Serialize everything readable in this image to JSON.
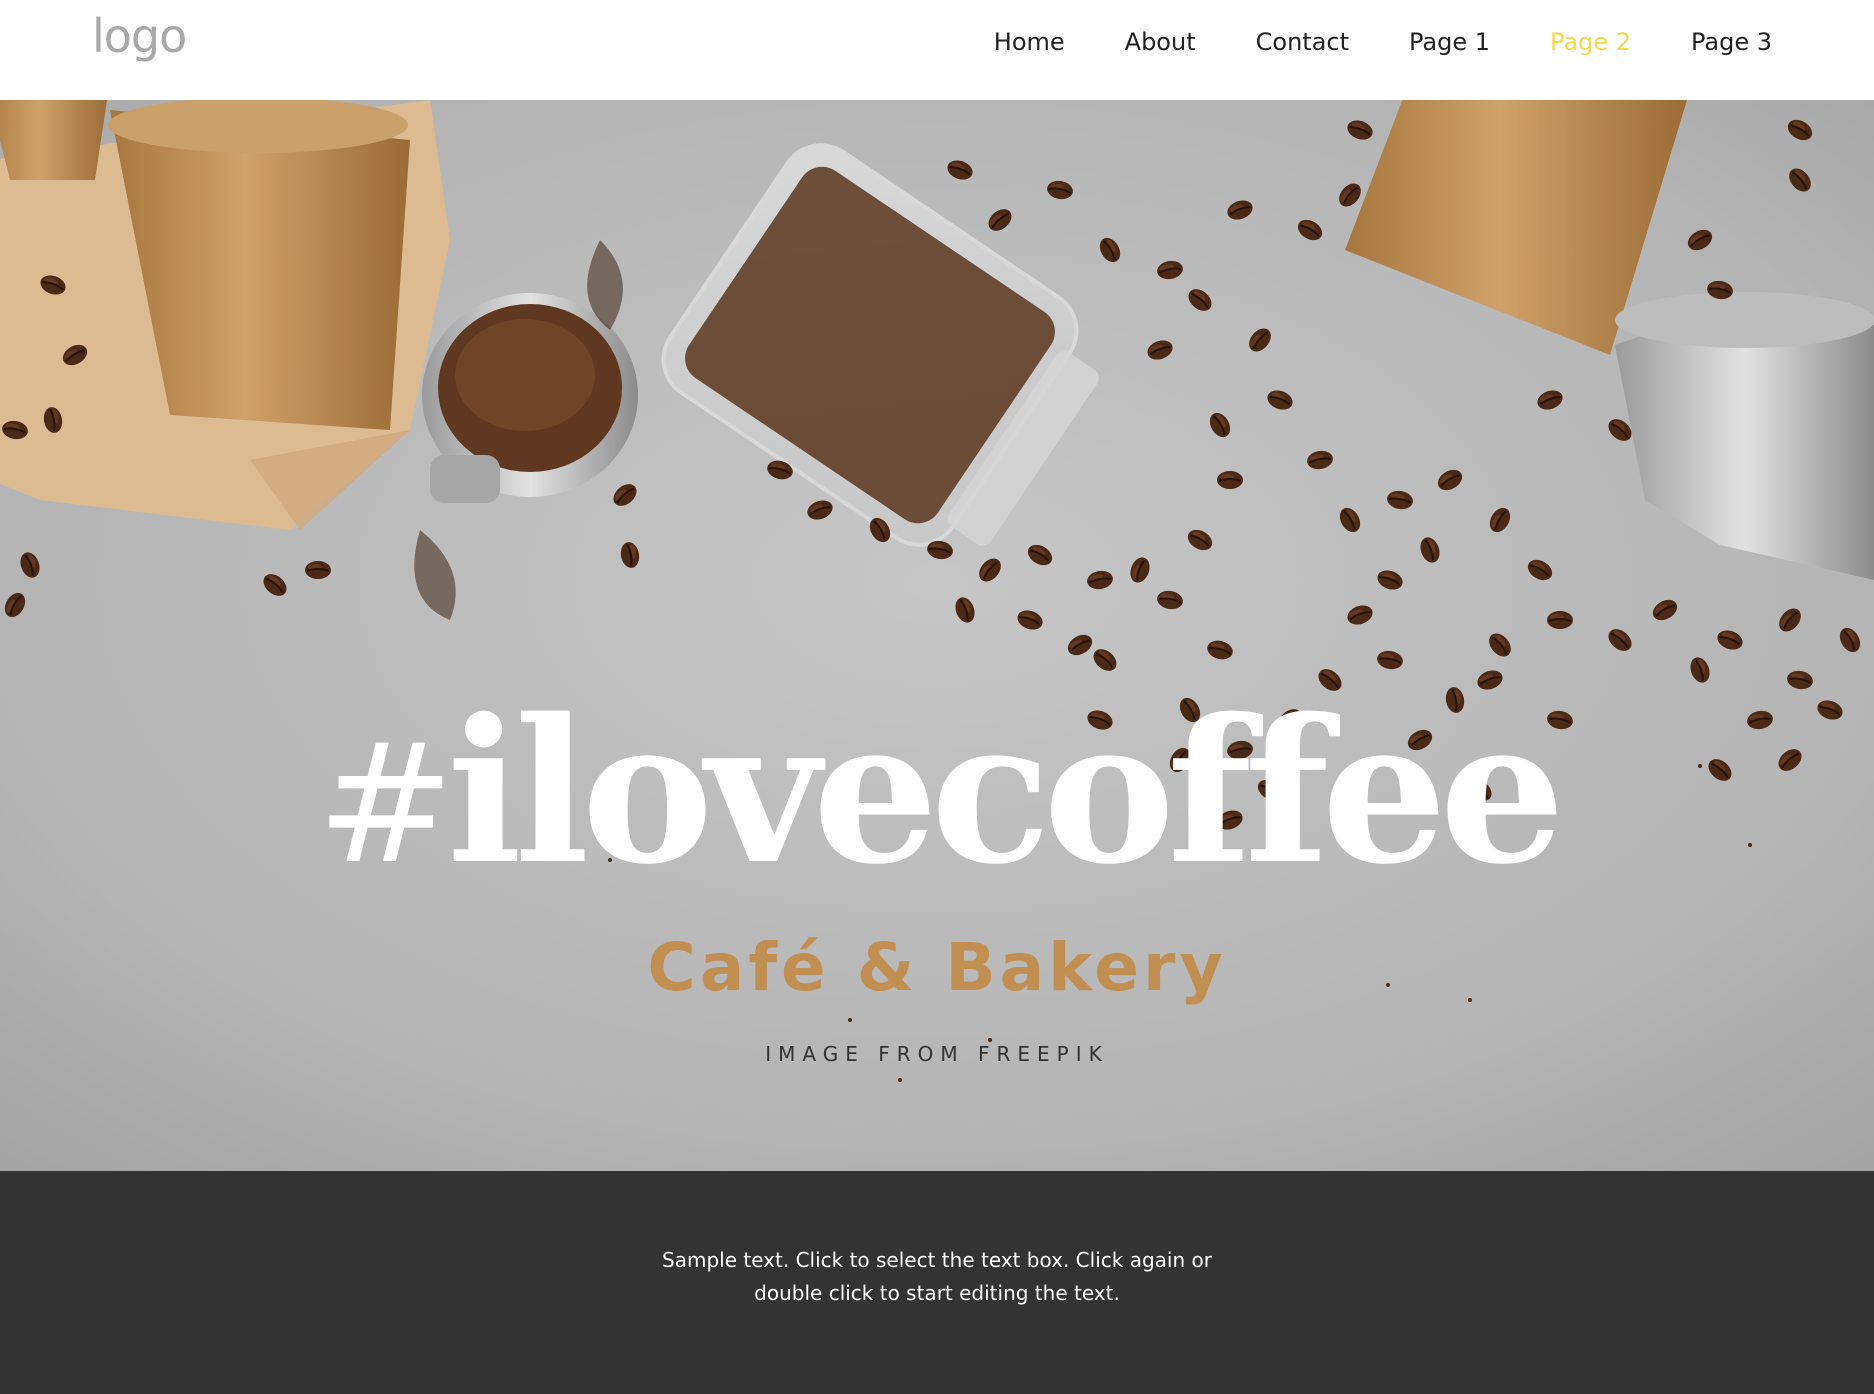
{
  "header": {
    "logo_text": "logo",
    "nav": [
      {
        "label": "Home"
      },
      {
        "label": "About"
      },
      {
        "label": "Contact"
      },
      {
        "label": "Page 1"
      },
      {
        "label": "Page 2",
        "active": true
      },
      {
        "label": "Page 3"
      }
    ],
    "active_color": "#f6d84b"
  },
  "hero": {
    "headline_hash": "#",
    "headline_word": "ilovecoffee",
    "subtitle": "Café & Bakery",
    "credit": "IMAGE FROM FREEPIK",
    "subtitle_color": "#c28f52"
  },
  "footer": {
    "text": "Sample text. Click to select the text box. Click again or double click to start editing the text.",
    "background": "#333333"
  }
}
